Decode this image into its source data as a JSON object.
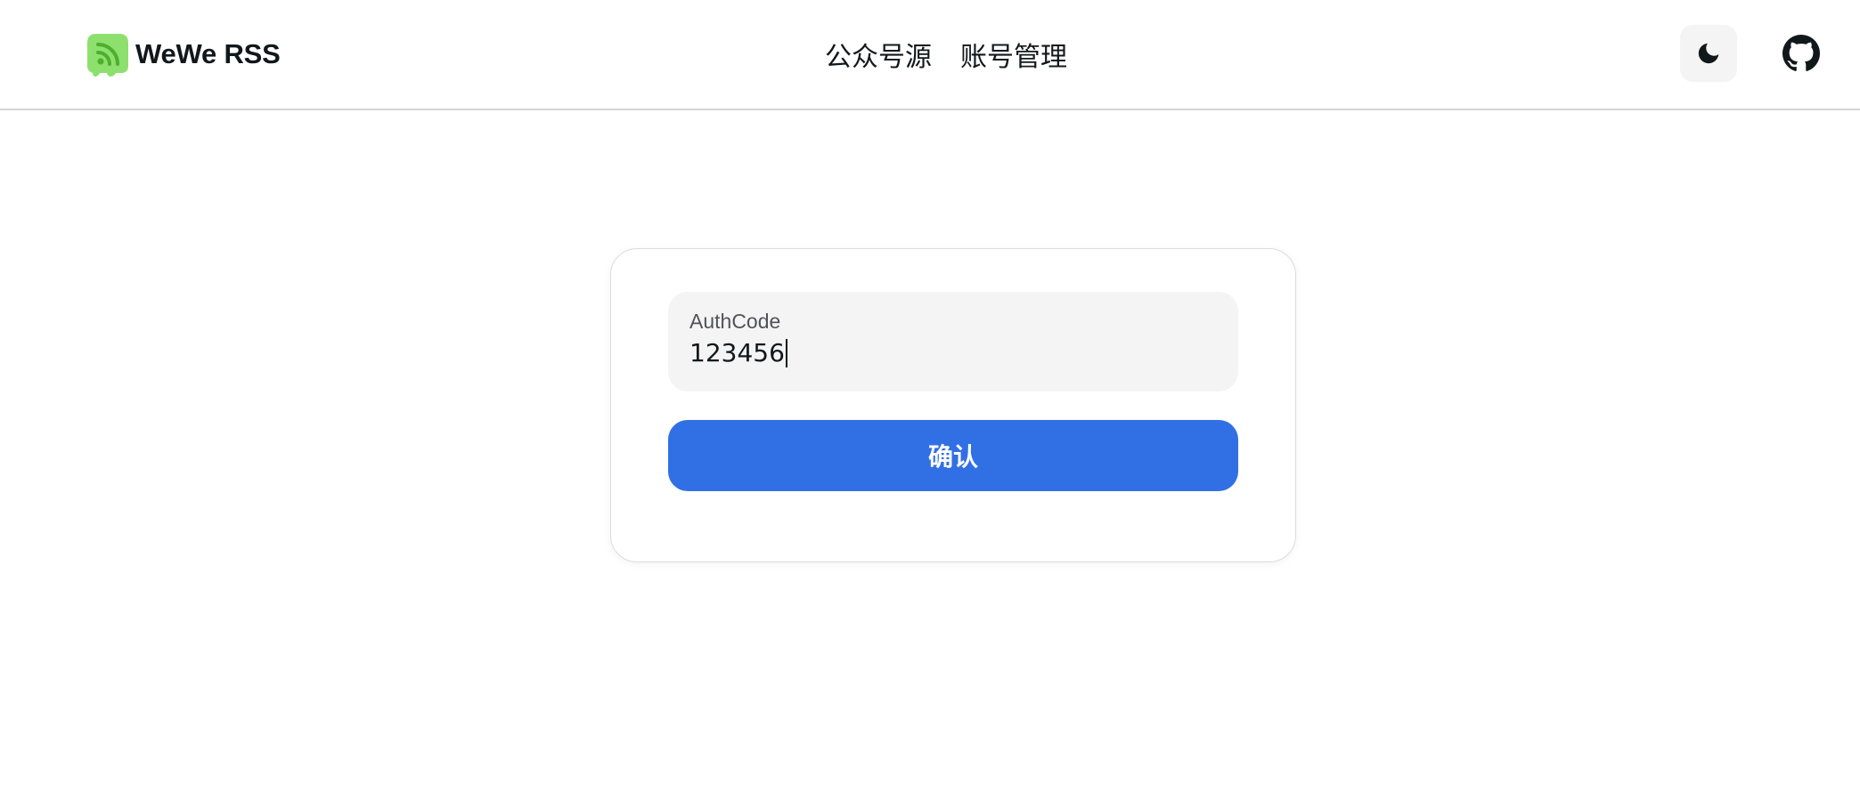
{
  "header": {
    "brand_name": "WeWe RSS",
    "logo_icon": "rss-chat-logo-icon",
    "nav": [
      {
        "label": "公众号源"
      },
      {
        "label": "账号管理"
      }
    ],
    "theme_toggle_icon": "moon-icon",
    "github_icon": "github-icon"
  },
  "auth_form": {
    "field_label": "AuthCode",
    "field_value": "123456",
    "submit_label": "确认"
  },
  "colors": {
    "primary": "#3170e4",
    "logo_green": "#8ee06e",
    "logo_icon_green": "#4caf2d",
    "input_bg": "#f4f4f5",
    "text": "#11181c"
  }
}
